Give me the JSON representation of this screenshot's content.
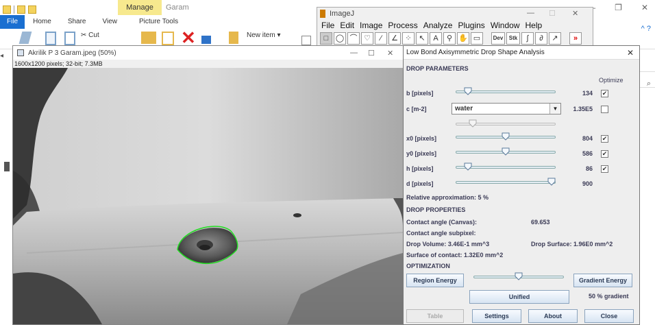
{
  "explorer": {
    "manage_tab": "Manage",
    "title": "Garam",
    "tabs": [
      "File",
      "Home",
      "Share",
      "View",
      "Picture Tools"
    ],
    "cut_label": "Cut",
    "new_item_label": "New item ▾",
    "min_glyph": "—",
    "max_glyph": "❐",
    "close_glyph": "✕",
    "help_glyph": "^ ?",
    "search_glyph": "⌕"
  },
  "imagej": {
    "title": "ImageJ",
    "menu": [
      "File",
      "Edit",
      "Image",
      "Process",
      "Analyze",
      "Plugins",
      "Window",
      "Help"
    ],
    "tools": [
      "□",
      "◯",
      "⌒",
      "♡",
      "∕",
      "∠",
      "⁘",
      "↖",
      "A",
      "⚲",
      "✋",
      "▭",
      "Dev",
      "Stk",
      "∫",
      "∂",
      "↗",
      "»"
    ]
  },
  "image_window": {
    "title": "Akrilik P 3 Garam.jpeg (50%)",
    "info": "1600x1200 pixels; 32-bit; 7.3MB"
  },
  "dialog": {
    "title": "Low Bond Axisymmetric Drop Shape Analysis",
    "close_glyph": "✕",
    "sections": {
      "params": "DROP PARAMETERS",
      "properties": "DROP PROPERTIES",
      "optimization": "OPTIMIZATION"
    },
    "optimize_header": "Optimize",
    "params": [
      {
        "label": "b [pixels]",
        "value": "134",
        "position": 0.09,
        "checked": true
      },
      {
        "label": "x0 [pixels]",
        "value": "804",
        "position": 0.5,
        "checked": true
      },
      {
        "label": "y0 [pixels]",
        "value": "586",
        "position": 0.5,
        "checked": true
      },
      {
        "label": "h [pixels]",
        "value": "86",
        "position": 0.09,
        "checked": true
      },
      {
        "label": "d [pixels]",
        "value": "900",
        "position": 1.0,
        "checked": null
      }
    ],
    "c_param": {
      "label": "c [m-2]",
      "combo": "water",
      "value": "1.35E5",
      "checked": false,
      "position": 0.14
    },
    "relative_approx": "Relative approximation: 5 %",
    "contact_angle_label": "Contact angle (Canvas):",
    "contact_angle_value": "69.653",
    "contact_subpixel": "Contact angle subpixel:",
    "drop_volume": "Drop Volume: 3.46E-1 mm^3",
    "drop_surface": "Drop Surface: 1.96E0 mm^2",
    "surface_contact": "Surface of contact: 1.32E0 mm^2",
    "opt_slider_position": 0.5,
    "region_energy": "Region Energy",
    "gradient_energy": "Gradient Energy",
    "unified": "Unified",
    "gradient_pct": "50 % gradient",
    "buttons": {
      "table": "Table",
      "settings": "Settings",
      "about": "About",
      "close": "Close"
    }
  }
}
